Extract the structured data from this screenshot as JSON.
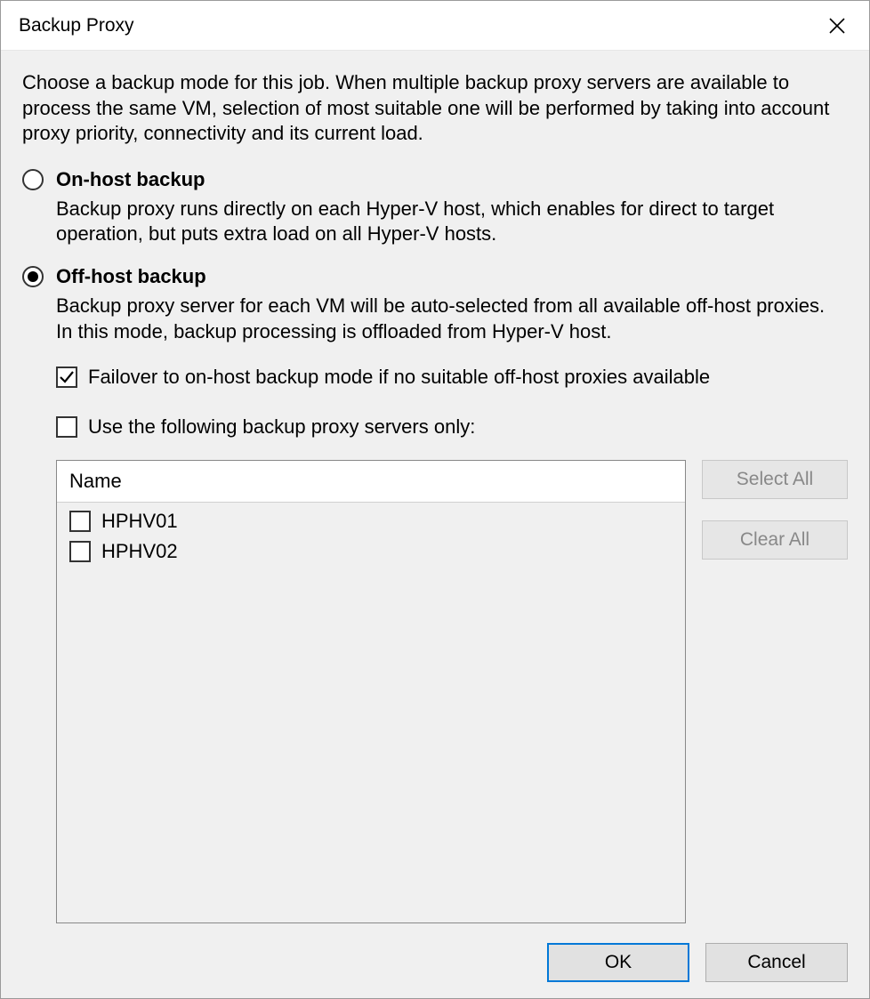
{
  "window": {
    "title": "Backup Proxy"
  },
  "intro": "Choose a backup mode for this job. When multiple backup proxy servers are available to process the same VM, selection of most suitable one will be performed by taking into account proxy priority, connectivity and its current load.",
  "options": {
    "on_host": {
      "label": "On-host backup",
      "description": "Backup proxy runs directly on each Hyper-V host, which enables for direct to target operation, but puts extra load on all Hyper-V hosts.",
      "selected": false
    },
    "off_host": {
      "label": "Off-host backup",
      "description": "Backup proxy server for each VM will be auto-selected from all available off-host proxies. In this mode, backup processing is offloaded from Hyper-V host.",
      "selected": true
    }
  },
  "checkboxes": {
    "failover": {
      "label": "Failover to on-host backup mode if no suitable off-host proxies available",
      "checked": true
    },
    "use_only": {
      "label": "Use the following backup proxy servers only:",
      "checked": false
    }
  },
  "proxy_list": {
    "header": "Name",
    "items": [
      {
        "label": "HPHV01",
        "checked": false
      },
      {
        "label": "HPHV02",
        "checked": false
      }
    ]
  },
  "buttons": {
    "select_all": "Select All",
    "clear_all": "Clear All",
    "ok": "OK",
    "cancel": "Cancel"
  }
}
